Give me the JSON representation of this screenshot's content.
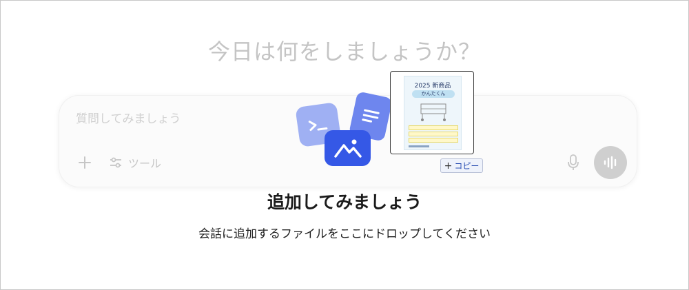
{
  "header": {
    "title": "今日は何をしましょうか？"
  },
  "composer": {
    "placeholder": "質問してみましょう",
    "add_icon": "plus-icon",
    "tools_label": "ツール",
    "tools_icon": "sliders-icon",
    "mic_icon": "microphone-icon",
    "voice_icon": "voice-waveform-icon"
  },
  "drop_overlay": {
    "heading": "追加してみましょう",
    "description": "会話に追加するファイルをここにドロップしてください",
    "copy_badge_label": "コピー",
    "icons": [
      "terminal-icon",
      "document-icon",
      "image-icon"
    ],
    "dragged_file": {
      "title": "2025 新商品",
      "subtitle": "かんたくん"
    }
  },
  "colors": {
    "accent": "#3558e6",
    "accent_light": "#9fb0f3",
    "accent_mid": "#6e86ee",
    "muted_text": "#c4c4c4"
  }
}
